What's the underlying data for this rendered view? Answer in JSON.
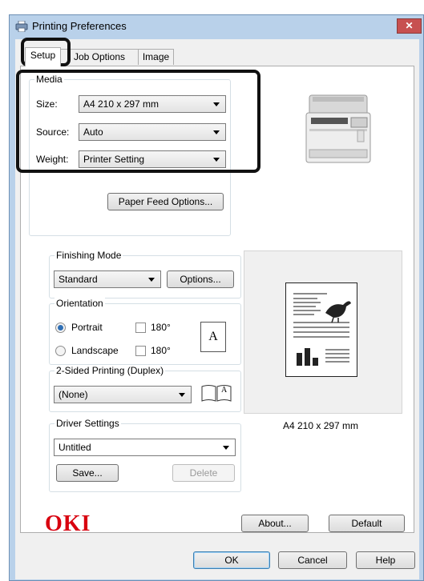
{
  "window": {
    "title": "Printing Preferences",
    "close_glyph": "✕"
  },
  "tabs": [
    {
      "label": "Setup"
    },
    {
      "label": "Job Options"
    },
    {
      "label": "Image"
    }
  ],
  "media": {
    "title": "Media",
    "size_label": "Size:",
    "size_value": "A4 210 x 297 mm",
    "source_label": "Source:",
    "source_value": "Auto",
    "weight_label": "Weight:",
    "weight_value": "Printer Setting",
    "paper_feed_button": "Paper Feed Options..."
  },
  "finishing": {
    "title": "Finishing Mode",
    "value": "Standard",
    "options_button": "Options..."
  },
  "orientation": {
    "title": "Orientation",
    "portrait_label": "Portrait",
    "landscape_label": "Landscape",
    "rotate_label": "180°",
    "rotate_label_2": "180°",
    "portrait_checked": true,
    "page_glyph": "A"
  },
  "duplex": {
    "title": "2-Sided Printing (Duplex)",
    "value": "(None)",
    "book_glyph": "A"
  },
  "driver": {
    "title": "Driver Settings",
    "value": "Untitled",
    "save_button": "Save...",
    "delete_button": "Delete"
  },
  "preview": {
    "paper_label": "A4 210 x 297 mm"
  },
  "brand": {
    "logo": "OKI",
    "color": "#d8000f"
  },
  "panel_buttons": {
    "about": "About...",
    "default": "Default"
  },
  "dialog_buttons": {
    "ok": "OK",
    "cancel": "Cancel",
    "help": "Help"
  }
}
